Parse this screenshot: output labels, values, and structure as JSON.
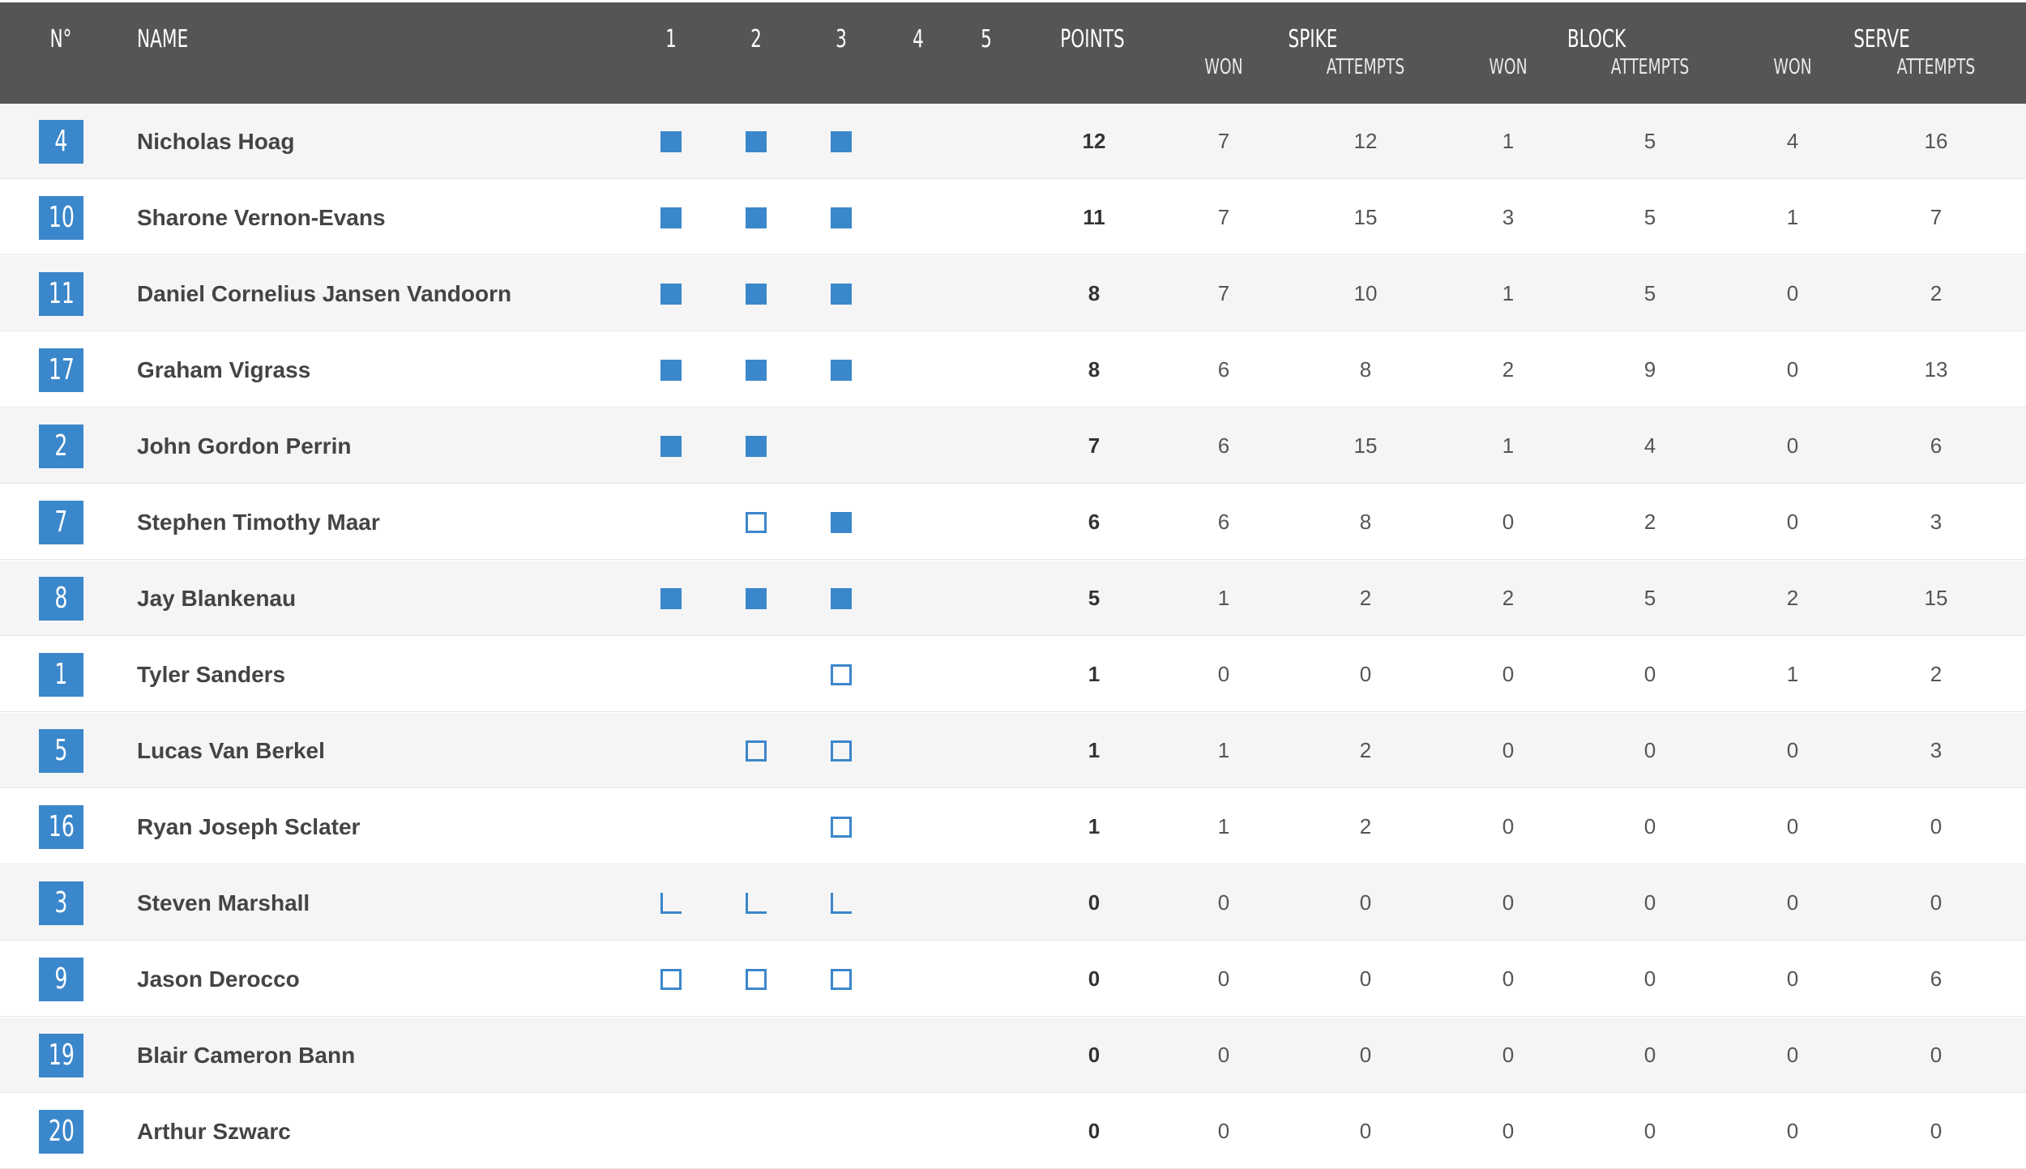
{
  "header": {
    "no": "N°",
    "name": "NAME",
    "sets": [
      "1",
      "2",
      "3",
      "4",
      "5"
    ],
    "points": "POINTS",
    "spike": "SPIKE",
    "block": "BLOCK",
    "serve": "SERVE",
    "won": "WON",
    "attempts": "ATTEMPTS"
  },
  "colors": {
    "header_bg": "#555555",
    "accent": "#3b87cb",
    "row_alt": "#f5f5f5"
  },
  "players": [
    {
      "number": "4",
      "name": "Nicholas Hoag",
      "sets": [
        "full",
        "full",
        "full",
        "",
        ""
      ],
      "points": "12",
      "spike_won": "7",
      "spike_attempts": "12",
      "block_won": "1",
      "block_attempts": "5",
      "serve_won": "4",
      "serve_attempts": "16"
    },
    {
      "number": "10",
      "name": "Sharone Vernon-Evans",
      "sets": [
        "full",
        "full",
        "full",
        "",
        ""
      ],
      "points": "11",
      "spike_won": "7",
      "spike_attempts": "15",
      "block_won": "3",
      "block_attempts": "5",
      "serve_won": "1",
      "serve_attempts": "7"
    },
    {
      "number": "11",
      "name": "Daniel Cornelius Jansen Vandoorn",
      "sets": [
        "full",
        "full",
        "full",
        "",
        ""
      ],
      "points": "8",
      "spike_won": "7",
      "spike_attempts": "10",
      "block_won": "1",
      "block_attempts": "5",
      "serve_won": "0",
      "serve_attempts": "2"
    },
    {
      "number": "17",
      "name": "Graham Vigrass",
      "sets": [
        "full",
        "full",
        "full",
        "",
        ""
      ],
      "points": "8",
      "spike_won": "6",
      "spike_attempts": "8",
      "block_won": "2",
      "block_attempts": "9",
      "serve_won": "0",
      "serve_attempts": "13"
    },
    {
      "number": "2",
      "name": "John Gordon Perrin",
      "sets": [
        "full",
        "full",
        "",
        "",
        ""
      ],
      "points": "7",
      "spike_won": "6",
      "spike_attempts": "15",
      "block_won": "1",
      "block_attempts": "4",
      "serve_won": "0",
      "serve_attempts": "6"
    },
    {
      "number": "7",
      "name": "Stephen Timothy Maar",
      "sets": [
        "",
        "outline",
        "full",
        "",
        ""
      ],
      "points": "6",
      "spike_won": "6",
      "spike_attempts": "8",
      "block_won": "0",
      "block_attempts": "2",
      "serve_won": "0",
      "serve_attempts": "3"
    },
    {
      "number": "8",
      "name": "Jay Blankenau",
      "sets": [
        "full",
        "full",
        "full",
        "",
        ""
      ],
      "points": "5",
      "spike_won": "1",
      "spike_attempts": "2",
      "block_won": "2",
      "block_attempts": "5",
      "serve_won": "2",
      "serve_attempts": "15"
    },
    {
      "number": "1",
      "name": "Tyler Sanders",
      "sets": [
        "",
        "",
        "outline",
        "",
        ""
      ],
      "points": "1",
      "spike_won": "0",
      "spike_attempts": "0",
      "block_won": "0",
      "block_attempts": "0",
      "serve_won": "1",
      "serve_attempts": "2"
    },
    {
      "number": "5",
      "name": "Lucas Van Berkel",
      "sets": [
        "",
        "outline",
        "outline",
        "",
        ""
      ],
      "points": "1",
      "spike_won": "1",
      "spike_attempts": "2",
      "block_won": "0",
      "block_attempts": "0",
      "serve_won": "0",
      "serve_attempts": "3"
    },
    {
      "number": "16",
      "name": "Ryan Joseph Sclater",
      "sets": [
        "",
        "",
        "outline",
        "",
        ""
      ],
      "points": "1",
      "spike_won": "1",
      "spike_attempts": "2",
      "block_won": "0",
      "block_attempts": "0",
      "serve_won": "0",
      "serve_attempts": "0"
    },
    {
      "number": "3",
      "name": "Steven Marshall",
      "sets": [
        "corner",
        "corner",
        "corner",
        "",
        ""
      ],
      "points": "0",
      "spike_won": "0",
      "spike_attempts": "0",
      "block_won": "0",
      "block_attempts": "0",
      "serve_won": "0",
      "serve_attempts": "0"
    },
    {
      "number": "9",
      "name": "Jason Derocco",
      "sets": [
        "outline",
        "outline",
        "outline",
        "",
        ""
      ],
      "points": "0",
      "spike_won": "0",
      "spike_attempts": "0",
      "block_won": "0",
      "block_attempts": "0",
      "serve_won": "0",
      "serve_attempts": "6"
    },
    {
      "number": "19",
      "name": "Blair Cameron Bann",
      "sets": [
        "",
        "",
        "",
        "",
        ""
      ],
      "points": "0",
      "spike_won": "0",
      "spike_attempts": "0",
      "block_won": "0",
      "block_attempts": "0",
      "serve_won": "0",
      "serve_attempts": "0"
    },
    {
      "number": "20",
      "name": "Arthur Szwarc",
      "sets": [
        "",
        "",
        "",
        "",
        ""
      ],
      "points": "0",
      "spike_won": "0",
      "spike_attempts": "0",
      "block_won": "0",
      "block_attempts": "0",
      "serve_won": "0",
      "serve_attempts": "0"
    }
  ]
}
